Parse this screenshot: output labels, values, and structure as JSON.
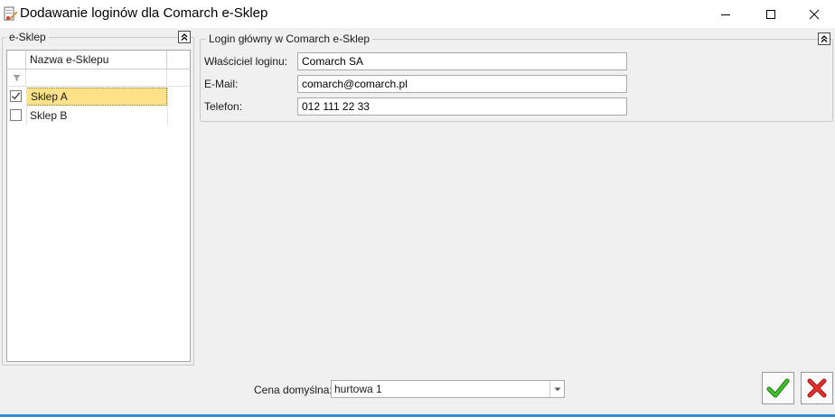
{
  "window": {
    "title": "Dodawanie loginów dla Comarch e-Sklep",
    "controls": [
      "minimize-icon",
      "maximize-icon",
      "close-icon"
    ]
  },
  "left_panel": {
    "legend": "e-Sklep",
    "grid": {
      "column_header": "Nazwa e-Sklepu",
      "rows": [
        {
          "name": "Sklep A",
          "checked": true,
          "selected": true
        },
        {
          "name": "Sklep B",
          "checked": false,
          "selected": false
        }
      ]
    }
  },
  "right_panel": {
    "legend": "Login główny w Comarch e-Sklep",
    "fields": [
      {
        "label": "Właściciel loginu:",
        "value": "Comarch SA"
      },
      {
        "label": "E-Mail:",
        "value": "comarch@comarch.pl"
      },
      {
        "label": "Telefon:",
        "value": "012 111 22 33"
      }
    ]
  },
  "footer": {
    "price_label": "Cena domyślna:",
    "price_value": "hurtowa 1",
    "confirm_icon": "checkmark-icon",
    "cancel_icon": "x-icon"
  },
  "colors": {
    "selected_row": "#fde28a",
    "confirm_green": "#2e9e1f",
    "cancel_red": "#d42020",
    "accent_line": "#2f8fd8"
  }
}
